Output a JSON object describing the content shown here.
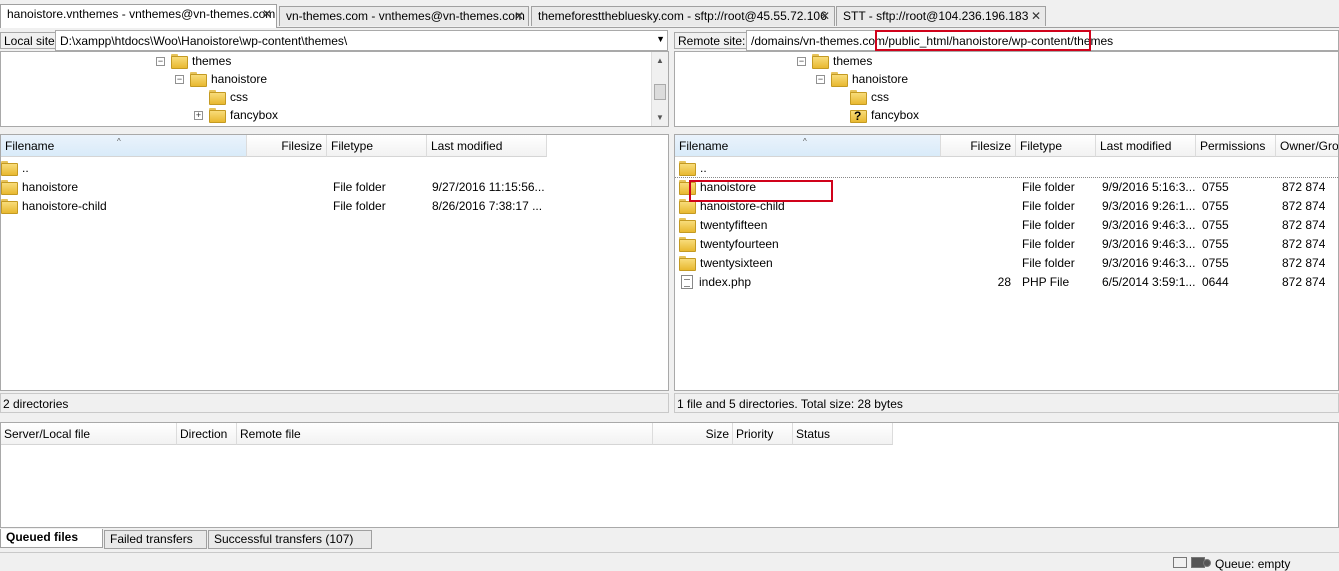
{
  "tabs": [
    {
      "label": "hanoistore.vnthemes - vnthemes@vn-themes.com",
      "active": true
    },
    {
      "label": "vn-themes.com - vnthemes@vn-themes.com",
      "active": false
    },
    {
      "label": "themeforestthebluesky.com - sftp://root@45.55.72.106",
      "active": false
    },
    {
      "label": "STT - sftp://root@104.236.196.183",
      "active": false
    }
  ],
  "close_glyph": "✕",
  "local": {
    "site_label": "Local site:",
    "path": "D:\\xampp\\htdocs\\Woo\\Hanoistore\\wp-content\\themes\\",
    "tree": [
      "themes",
      "hanoistore",
      "css",
      "fancybox"
    ],
    "columns": [
      "Filename",
      "Filesize",
      "Filetype",
      "Last modified"
    ],
    "files": [
      {
        "name": "..",
        "size": "",
        "type": "",
        "modified": ""
      },
      {
        "name": "hanoistore",
        "size": "",
        "type": "File folder",
        "modified": "9/27/2016 11:15:56..."
      },
      {
        "name": "hanoistore-child",
        "size": "",
        "type": "File folder",
        "modified": "8/26/2016 7:38:17 ..."
      }
    ],
    "status": "2 directories"
  },
  "remote": {
    "site_label": "Remote site:",
    "path": "/domains/vn-themes.com/public_html/hanoistore/wp-content/themes",
    "tree": [
      "themes",
      "hanoistore",
      "css",
      "fancybox"
    ],
    "columns": [
      "Filename",
      "Filesize",
      "Filetype",
      "Last modified",
      "Permissions",
      "Owner/Gro"
    ],
    "files": [
      {
        "name": "..",
        "size": "",
        "type": "",
        "modified": "",
        "perm": "",
        "owner": ""
      },
      {
        "name": "hanoistore",
        "size": "",
        "type": "File folder",
        "modified": "9/9/2016 5:16:3...",
        "perm": "0755",
        "owner": "872 874"
      },
      {
        "name": "hanoistore-child",
        "size": "",
        "type": "File folder",
        "modified": "9/3/2016 9:26:1...",
        "perm": "0755",
        "owner": "872 874"
      },
      {
        "name": "twentyfifteen",
        "size": "",
        "type": "File folder",
        "modified": "9/3/2016 9:46:3...",
        "perm": "0755",
        "owner": "872 874"
      },
      {
        "name": "twentyfourteen",
        "size": "",
        "type": "File folder",
        "modified": "9/3/2016 9:46:3...",
        "perm": "0755",
        "owner": "872 874"
      },
      {
        "name": "twentysixteen",
        "size": "",
        "type": "File folder",
        "modified": "9/3/2016 9:46:3...",
        "perm": "0755",
        "owner": "872 874"
      },
      {
        "name": "index.php",
        "size": "28",
        "type": "PHP File",
        "modified": "6/5/2014 3:59:1...",
        "perm": "0644",
        "owner": "872 874"
      }
    ],
    "status": "1 file and 5 directories. Total size: 28 bytes"
  },
  "queue": {
    "columns": [
      "Server/Local file",
      "Direction",
      "Remote file",
      "Size",
      "Priority",
      "Status"
    ],
    "tabs": [
      "Queued files",
      "Failed transfers",
      "Successful transfers (107)"
    ]
  },
  "statusbar": {
    "queue_label": "Queue: empty"
  },
  "colors": {
    "highlight": "#d0021b",
    "sorted_header": "#d9ebf9"
  }
}
